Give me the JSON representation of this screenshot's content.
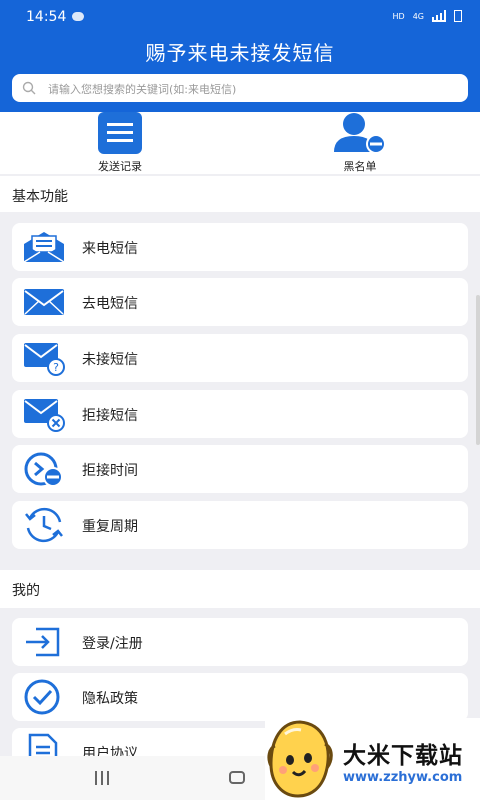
{
  "status_bar": {
    "time": "14:54",
    "indicators": [
      "HD",
      "4G"
    ]
  },
  "app": {
    "title": "赐予来电未接发短信",
    "search_placeholder": "请输入您想搜索的关键词(如:来电短信)"
  },
  "quick_actions": [
    {
      "label": "发送记录",
      "icon": "clipboard-icon"
    },
    {
      "label": "黑名单",
      "icon": "user-block-icon"
    }
  ],
  "sections": {
    "basic": {
      "title": "基本功能",
      "items": [
        {
          "label": "来电短信",
          "icon": "open-envelope-icon"
        },
        {
          "label": "去电短信",
          "icon": "envelope-icon"
        },
        {
          "label": "未接短信",
          "icon": "envelope-question-icon"
        },
        {
          "label": "拒接短信",
          "icon": "envelope-x-icon"
        },
        {
          "label": "拒接时间",
          "icon": "clock-block-icon"
        },
        {
          "label": "重复周期",
          "icon": "repeat-clock-icon"
        }
      ]
    },
    "mine": {
      "title": "我的",
      "items": [
        {
          "label": "登录/注册",
          "icon": "login-icon"
        },
        {
          "label": "隐私政策",
          "icon": "check-circle-icon"
        },
        {
          "label": "用户协议",
          "icon": "document-icon"
        }
      ]
    }
  },
  "watermark": {
    "brand": "大米下载站",
    "url": "www.zzhyw.com"
  },
  "colors": {
    "primary": "#1565d8",
    "background": "#efeff3",
    "card": "#ffffff"
  }
}
